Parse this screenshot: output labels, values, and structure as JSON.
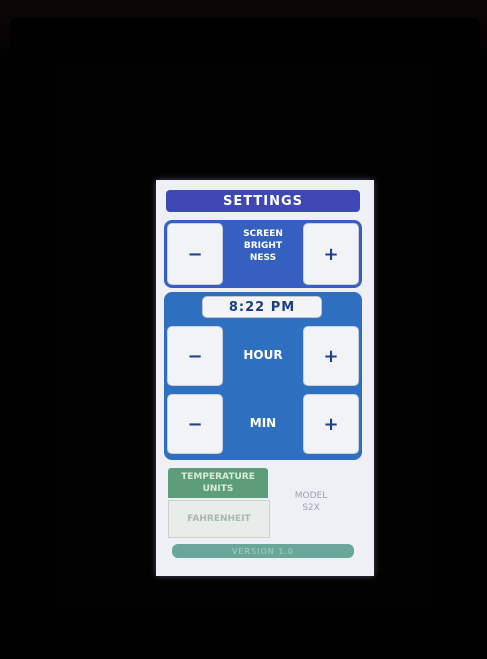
{
  "settings": {
    "title": "SETTINGS",
    "brightness": {
      "label_lines": [
        "SCREEN",
        "BRIGHT",
        "NESS"
      ],
      "minus": "−",
      "plus": "+"
    },
    "time": {
      "display": "8:22 PM",
      "hour_label": "HOUR",
      "min_label": "MIN",
      "minus": "−",
      "plus": "+"
    },
    "temperature": {
      "label_lines": [
        "TEMPERATURE",
        "UNITS"
      ],
      "value": "FAHRENHEIT"
    },
    "model": {
      "label_lines": [
        "MODEL",
        "S2X"
      ]
    },
    "version": "VERSION 1.0"
  },
  "colors": {
    "title_bar": "#3e47b4",
    "panel": "#2f6fc0",
    "temperature": "#5e9d7a",
    "screen_bg": "#eef0f5"
  }
}
